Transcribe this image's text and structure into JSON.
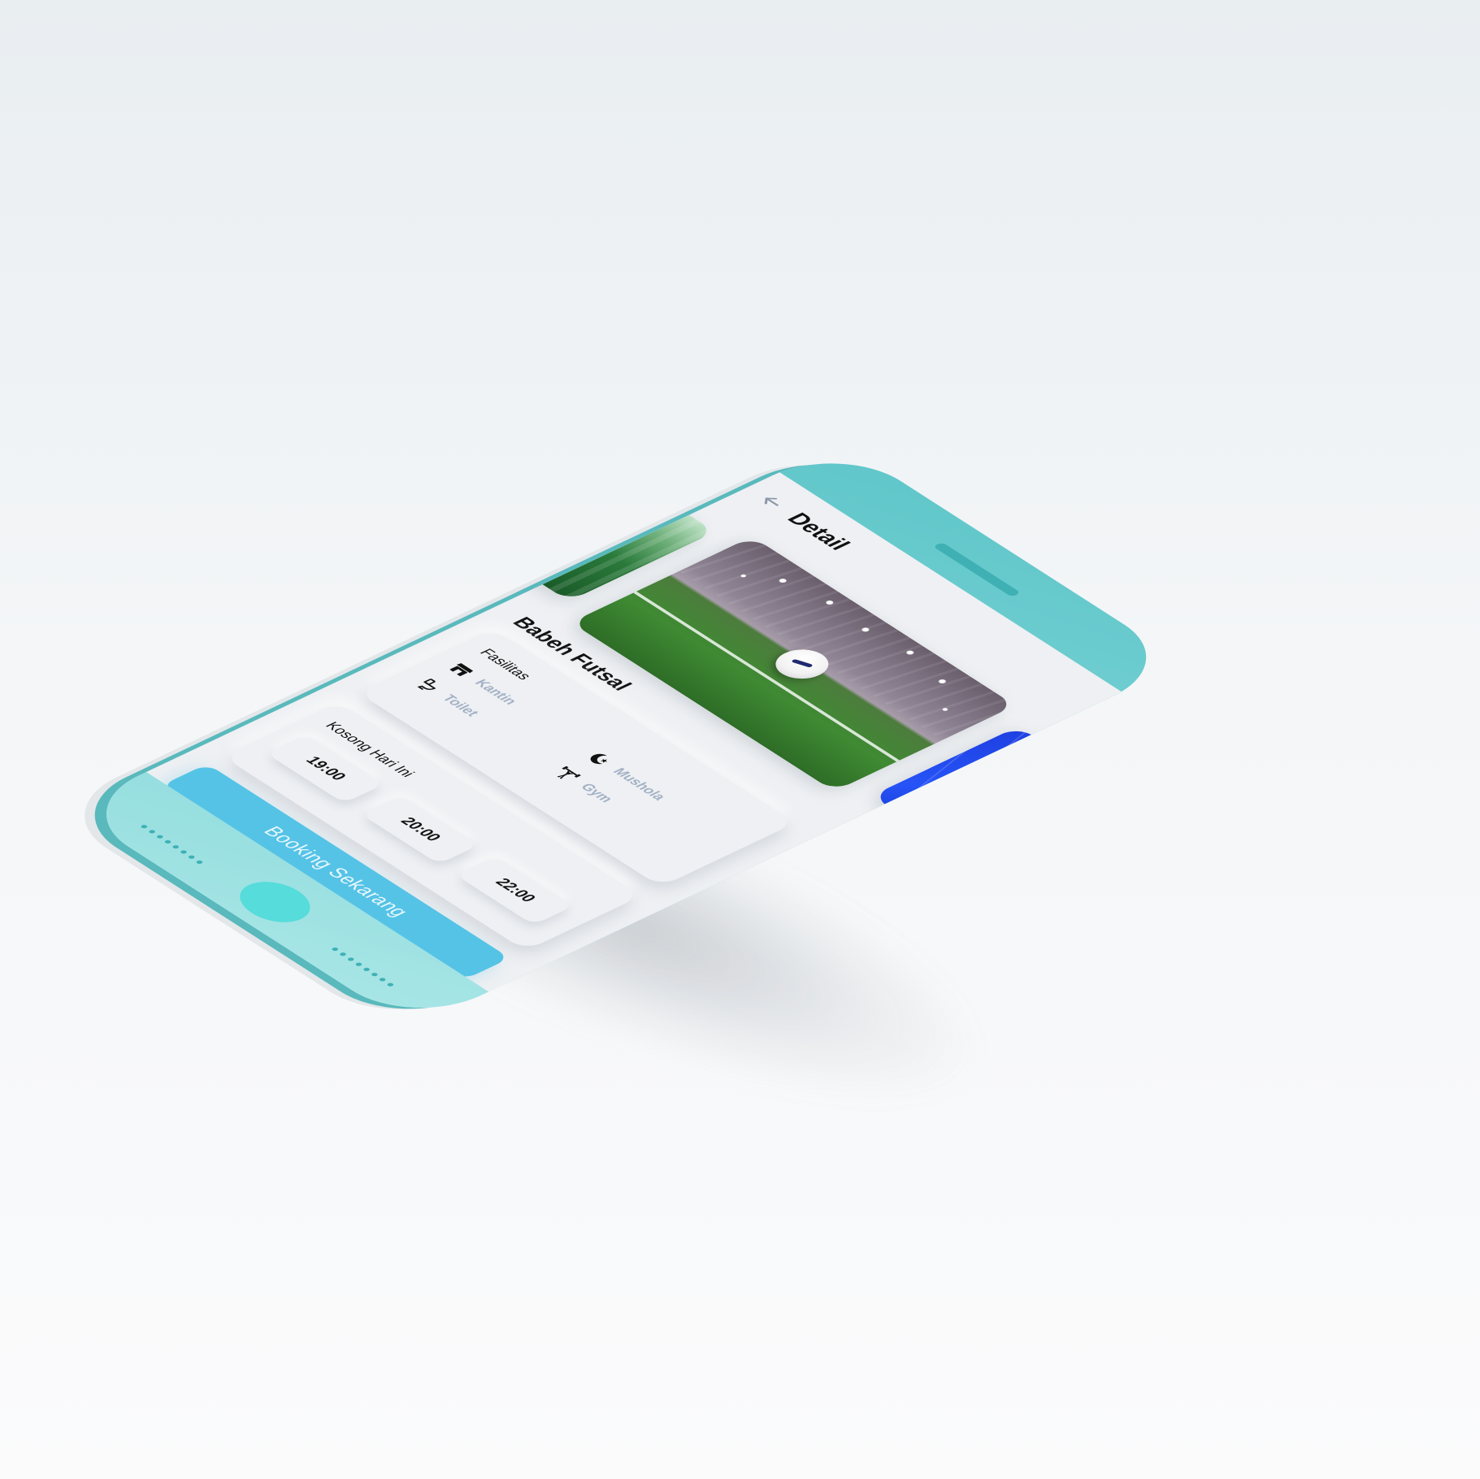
{
  "header": {
    "title": "Detail",
    "back_icon": "arrow-left-icon"
  },
  "gallery": {
    "images": [
      {
        "name": "green-turf-pitch"
      },
      {
        "name": "indoor-pitch-with-ball"
      },
      {
        "name": "blue-futsal-court"
      }
    ]
  },
  "venue": {
    "name": "Babeh Futsal"
  },
  "facilities": {
    "title": "Fasilitas",
    "items": [
      {
        "label": "Kantin",
        "icon": "store-icon"
      },
      {
        "label": "Mushola",
        "icon": "crescent-star-icon"
      },
      {
        "label": "Toilet",
        "icon": "toilet-icon"
      },
      {
        "label": "Gym",
        "icon": "weightlifter-icon"
      }
    ]
  },
  "availability": {
    "title": "Kosong Hari Ini",
    "slots": [
      "19:00",
      "20:00",
      "22:00"
    ]
  },
  "cta": {
    "label": "Booking Sekarang"
  },
  "colors": {
    "phone_body": "#6fcfd1",
    "screen_bg": "#eef0f3",
    "button": "#55c3e6",
    "facility_label": "#a3b1c5",
    "home_button": "#56dcdb"
  }
}
